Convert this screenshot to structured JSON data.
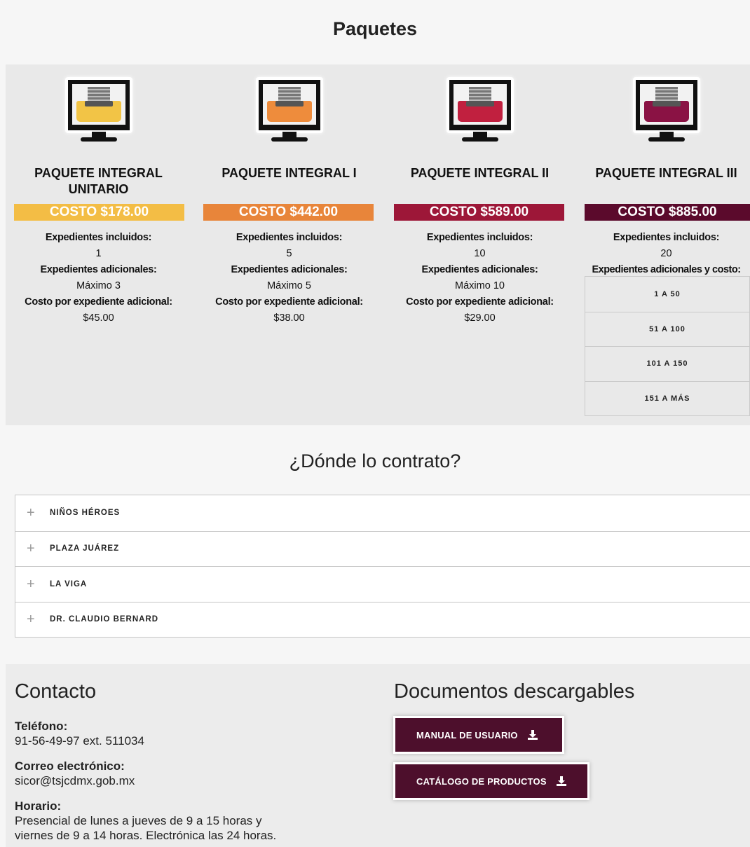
{
  "paquetes": {
    "title": "Paquetes",
    "packages": [
      {
        "name": "PAQUETE INTEGRAL UNITARIO",
        "cost": "COSTO $178.00",
        "color": "#f3bd45",
        "tray_color": "#f2c446",
        "icon": "monitor-inbox-icon",
        "included_label": "Expedientes incluidos:",
        "included_value": "1",
        "additional_label": "Expedientes adicionales:",
        "additional_value": "Máximo 3",
        "extra_cost_label": "Costo por expediente adicional:",
        "extra_cost_value": "$45.00"
      },
      {
        "name": "PAQUETE INTEGRAL I",
        "cost": "COSTO $442.00",
        "color": "#e8853a",
        "tray_color": "#ee8c3c",
        "icon": "monitor-inbox-icon",
        "included_label": "Expedientes incluidos:",
        "included_value": "5",
        "additional_label": "Expedientes adicionales:",
        "additional_value": "Máximo 5",
        "extra_cost_label": "Costo por expediente adicional:",
        "extra_cost_value": "$38.00"
      },
      {
        "name": "PAQUETE INTEGRAL II",
        "cost": "COSTO $589.00",
        "color": "#9d1738",
        "tray_color": "#c1203f",
        "icon": "monitor-inbox-icon",
        "included_label": "Expedientes incluidos:",
        "included_value": "10",
        "additional_label": "Expedientes adicionales:",
        "additional_value": "Máximo 10",
        "extra_cost_label": "Costo por expediente adicional:",
        "extra_cost_value": "$29.00"
      },
      {
        "name": "PAQUETE INTEGRAL III",
        "cost": "COSTO $885.00",
        "color": "#5b0a2c",
        "tray_color": "#8a1244",
        "icon": "monitor-inbox-icon",
        "included_label": "Expedientes incluidos:",
        "included_value": "20",
        "additional_label": "Expedientes adicionales y costo:",
        "ranges": [
          "1 A 50",
          "51 A 100",
          "101 A 150",
          "151 A MÁS"
        ]
      }
    ]
  },
  "donde": {
    "title": "¿Dónde lo contrato?",
    "locations": [
      "NIÑOS HÉROES",
      "PLAZA JUÁREZ",
      "LA VIGA",
      "DR. CLAUDIO BERNARD"
    ],
    "expand_icon": "plus-icon"
  },
  "contacto": {
    "title": "Contacto",
    "phone_label": "Teléfono:",
    "phone_value": "91-56-49-97 ext. 511034",
    "email_label": "Correo electrónico:",
    "email_value": "sicor@tsjcdmx.gob.mx",
    "hours_label": "Horario:",
    "hours_line1": "Presencial de lunes a jueves de 9 a 15 horas y",
    "hours_line2": "viernes de 9 a 14 horas. Electrónica las 24 horas."
  },
  "documentos": {
    "title": "Documentos descargables",
    "buttons": [
      {
        "label": "MANUAL DE USUARIO",
        "icon": "download-icon"
      },
      {
        "label": "CATÁLOGO DE PRODUCTOS",
        "icon": "download-icon"
      }
    ],
    "button_color": "#4d0f2c"
  }
}
